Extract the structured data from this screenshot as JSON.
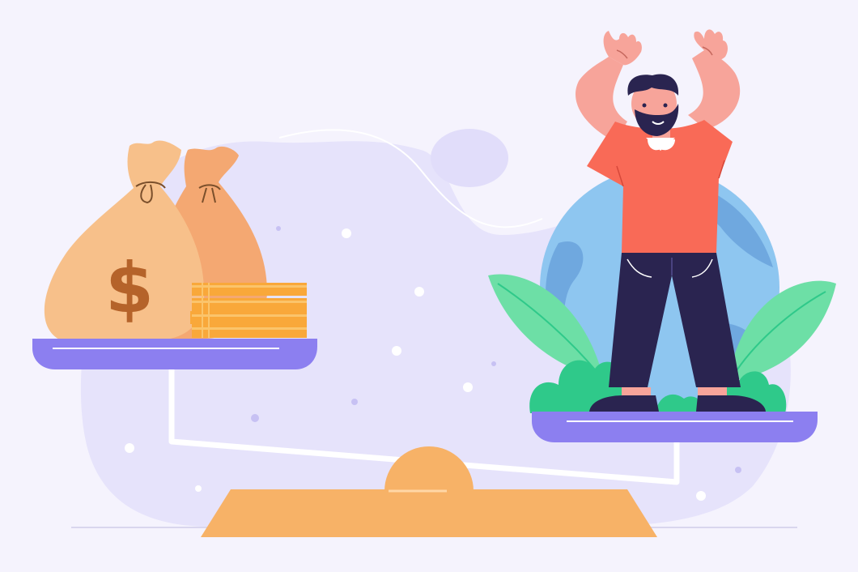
{
  "illustration": {
    "money_bag_symbol": "$",
    "colors": {
      "background": "#f5f3fd",
      "blob": "#e6e3fb",
      "ground_line": "#d9d6ee",
      "scale_plate": "#8c7ff0",
      "scale_plate_top": "#bdb6f8",
      "scale_base": "#f7b267",
      "scale_beam": "#ffffff",
      "bag_front": "#f7c08a",
      "bag_back": "#f4a872",
      "dollar": "#b5632a",
      "coins": "#f9a83a",
      "coins_stripe": "#fbc46b",
      "globe": "#8ec6f0",
      "globe_land": "#6fa8df",
      "leaves": "#6ddfa6",
      "leaves_dark": "#2fc98a",
      "shirt": "#f96a57",
      "skin": "#f7a49a",
      "pants": "#2a2450",
      "hair": "#2a2450",
      "collar": "#ffffff",
      "shoes": "#2a2450"
    },
    "scale_tilt": "left-side-down",
    "icons": [
      "money-bag-icon",
      "money-bag-icon",
      "coin-stack-icon",
      "globe-icon",
      "leaves-icon",
      "person-icon"
    ]
  }
}
